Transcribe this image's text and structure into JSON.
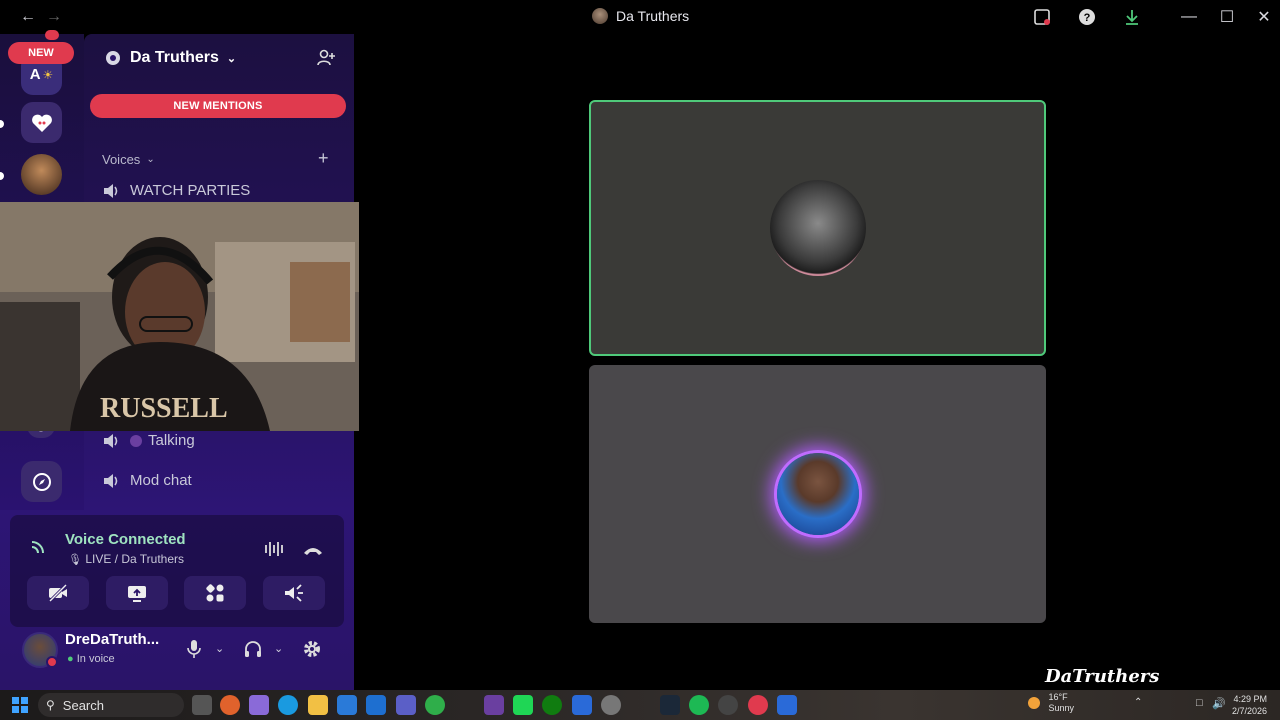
{
  "window": {
    "title": "Da Truthers",
    "colors": {
      "accent_red": "#e03a4e",
      "speaking_green": "#4fc97a",
      "voice_connected": "#9fe3c0"
    }
  },
  "server_rail": {
    "new_badge": "NEW",
    "avatar_letter": "A"
  },
  "sidebar": {
    "server_name": "Da Truthers",
    "new_mentions_label": "NEW MENTIONS",
    "category_label": "Voices",
    "channels": [
      {
        "name": "WATCH PARTIES"
      },
      {
        "name": "Talking"
      },
      {
        "name": "Mod chat"
      }
    ]
  },
  "voice": {
    "status": "Voice Connected",
    "channel": "LIVE / Da Truthers"
  },
  "user": {
    "display_name": "DreDaTruth...",
    "status": "In voice"
  },
  "stage": {
    "watermark": "DaTruthers"
  },
  "taskbar": {
    "search_label": "Search",
    "weather_temp": "16°F",
    "weather_desc": "Sunny",
    "time": "4:29 PM",
    "date": "2/7/2026"
  }
}
